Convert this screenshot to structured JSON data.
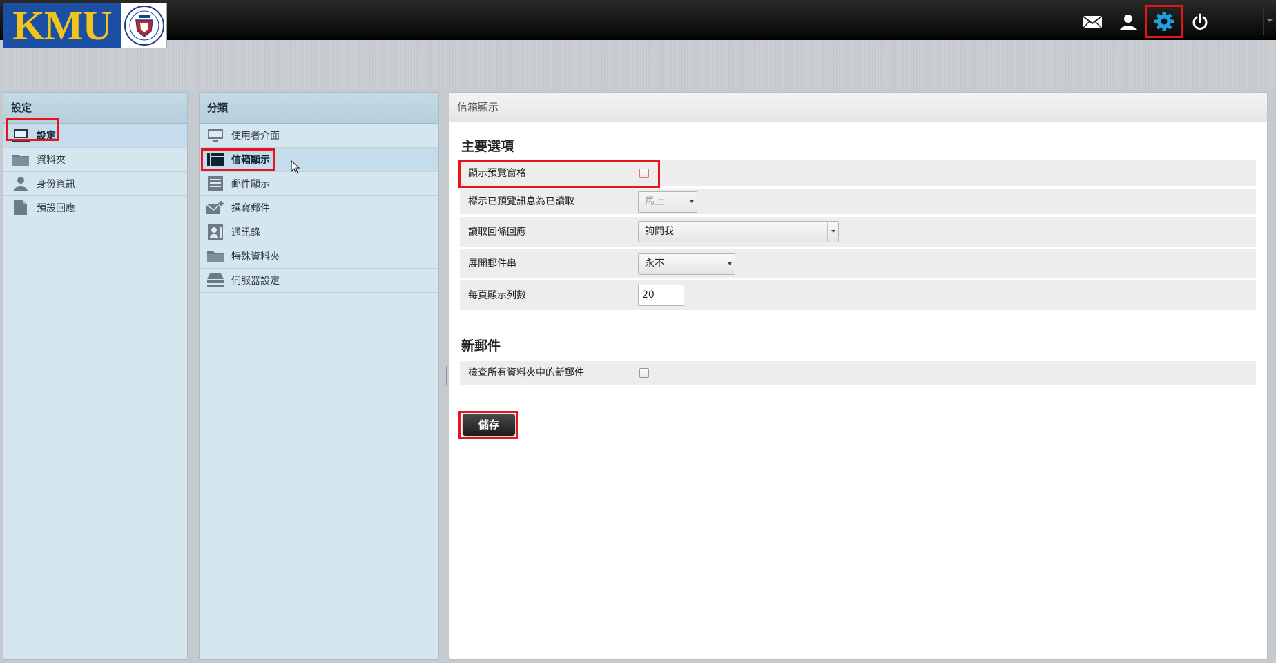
{
  "topbar": {
    "logo_text": "KMU",
    "icons": [
      "mail-icon",
      "user-icon",
      "gear-icon",
      "power-icon"
    ]
  },
  "settings_panel": {
    "title": "設定",
    "items": [
      {
        "label": "設定",
        "icon": "monitor-icon",
        "selected": true
      },
      {
        "label": "資料夾",
        "icon": "folder-icon",
        "selected": false
      },
      {
        "label": "身份資訊",
        "icon": "person-icon",
        "selected": false
      },
      {
        "label": "預設回應",
        "icon": "document-icon",
        "selected": false
      }
    ]
  },
  "category_panel": {
    "title": "分類",
    "items": [
      {
        "label": "使用者介面",
        "icon": "monitor-icon",
        "selected": false
      },
      {
        "label": "信箱顯示",
        "icon": "mailbox-layout-icon",
        "selected": true
      },
      {
        "label": "郵件顯示",
        "icon": "message-view-icon",
        "selected": false
      },
      {
        "label": "撰寫郵件",
        "icon": "compose-icon",
        "selected": false
      },
      {
        "label": "通訊錄",
        "icon": "addressbook-icon",
        "selected": false
      },
      {
        "label": "特殊資料夾",
        "icon": "folder-icon",
        "selected": false
      },
      {
        "label": "伺服器設定",
        "icon": "server-icon",
        "selected": false
      }
    ]
  },
  "main": {
    "title": "信箱顯示",
    "section_main": "主要選項",
    "show_preview_label": "顯示預覽窗格",
    "mark_read_label": "標示已預覽訊息為已讀取",
    "mark_read_value": "馬上",
    "receipt_label": "讀取回條回應",
    "receipt_value": "詢問我",
    "threads_label": "展開郵件串",
    "threads_value": "永不",
    "rows_label": "每頁顯示列數",
    "rows_value": "20",
    "section_new": "新郵件",
    "check_all_label": "檢查所有資料夾中的新郵件",
    "save_label": "儲存"
  },
  "colors": {
    "highlight": "#e8141c",
    "gear_active": "#1e9fe0",
    "panel_bg": "#d6e6ef"
  }
}
